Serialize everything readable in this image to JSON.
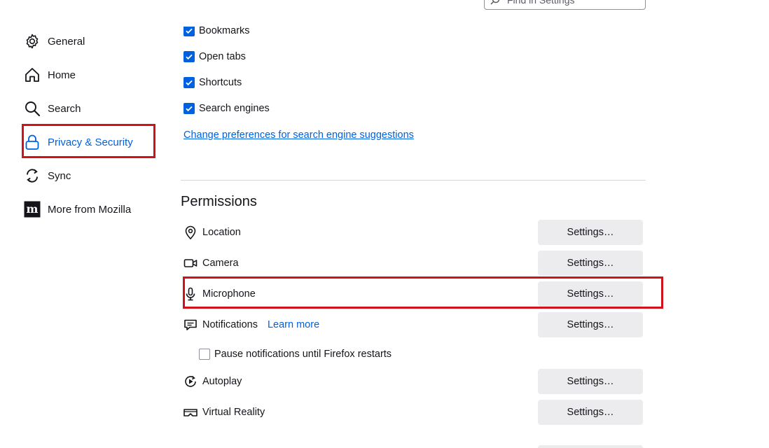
{
  "search": {
    "placeholder": "Find in Settings"
  },
  "sidebar": {
    "items": [
      {
        "label": "General",
        "icon": "gear-icon"
      },
      {
        "label": "Home",
        "icon": "home-icon"
      },
      {
        "label": "Search",
        "icon": "search-icon"
      },
      {
        "label": "Privacy & Security",
        "icon": "lock-icon",
        "selected": true
      },
      {
        "label": "Sync",
        "icon": "sync-icon"
      },
      {
        "label": "More from Mozilla",
        "icon": "mozilla-icon"
      }
    ]
  },
  "suggestions": {
    "checkboxes": [
      {
        "label": "Bookmarks",
        "checked": true
      },
      {
        "label": "Open tabs",
        "checked": true
      },
      {
        "label": "Shortcuts",
        "checked": true
      },
      {
        "label": "Search engines",
        "checked": true
      }
    ],
    "link": "Change preferences for search engine suggestions"
  },
  "permissions": {
    "title": "Permissions",
    "button_label": "Settings…",
    "items": [
      {
        "label": "Location",
        "icon": "location-icon"
      },
      {
        "label": "Camera",
        "icon": "camera-icon"
      },
      {
        "label": "Microphone",
        "icon": "microphone-icon"
      },
      {
        "label": "Notifications",
        "icon": "notifications-icon",
        "learn_more": "Learn more"
      },
      {
        "label": "Autoplay",
        "icon": "autoplay-icon"
      },
      {
        "label": "Virtual Reality",
        "icon": "vr-icon"
      }
    ],
    "pause_notifications": {
      "label": "Pause notifications until Firefox restarts",
      "checked": false
    }
  },
  "colors": {
    "accent": "#0061e0",
    "highlight": "#d0121b",
    "button_bg": "#ececef",
    "text": "#15141a"
  }
}
